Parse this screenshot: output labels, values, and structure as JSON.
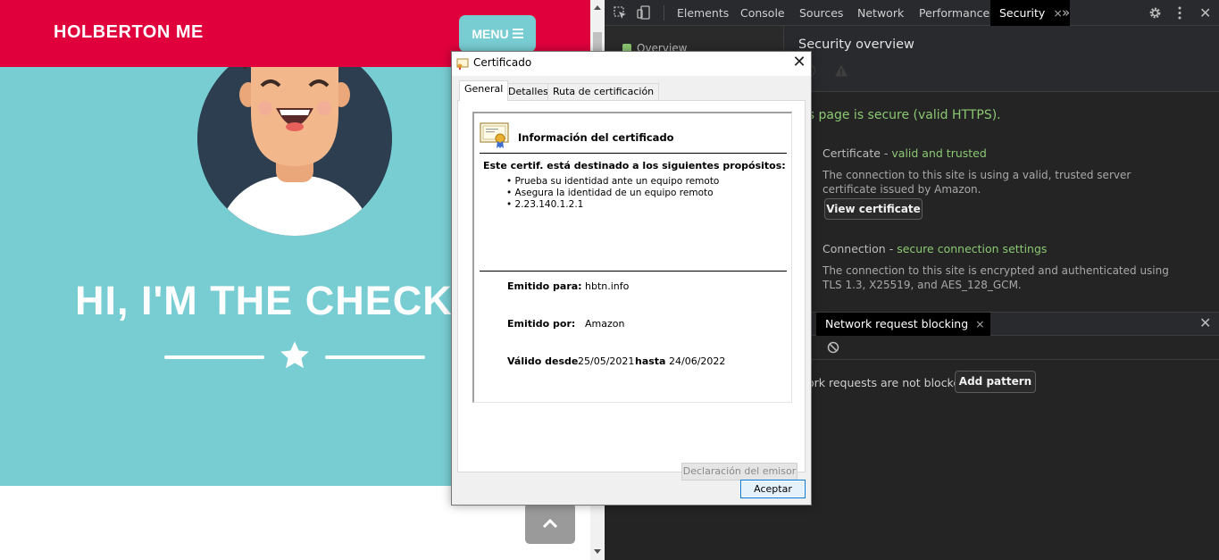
{
  "site": {
    "brand": "HOLBERTON ME",
    "menu_label": "MENU",
    "hero_title": "HI, I'M THE CHECK",
    "colors": {
      "nav": "#e0003c",
      "hero": "#78cdd3"
    }
  },
  "devtools": {
    "tabs": [
      "Elements",
      "Console",
      "Sources",
      "Network",
      "Performance",
      "Security"
    ],
    "active_tab": "Security",
    "sidebar_item": "Overview",
    "security": {
      "title": "Security overview",
      "secure_message": "his page is secure (valid HTTPS).",
      "certificate_label": "Certificate - ",
      "certificate_status": "valid and trusted",
      "certificate_desc": "The connection to this site is using a valid, trusted server certificate issued by Amazon.",
      "view_certificate": "View certificate",
      "connection_label": "Connection - ",
      "connection_status": "secure connection settings",
      "connection_desc": "The connection to this site is encrypted and authenticated using TLS 1.3, X25519, and AES_128_GCM."
    },
    "drawer": {
      "tab": "Network request blocking",
      "message": "ork requests are not blocked.",
      "add_pattern": "Add pattern"
    }
  },
  "cert_dialog": {
    "title": "Certificado",
    "tabs": [
      "General",
      "Detalles",
      "Ruta de certificación"
    ],
    "info_title": "Información del certificado",
    "purpose_heading": "Este certif. está destinado a los siguientes propósitos:",
    "purposes": [
      "• Prueba su identidad ante un equipo remoto",
      "• Asegura la identidad de un equipo remoto",
      "• 2.23.140.1.2.1"
    ],
    "issued_to_label": "Emitido para:",
    "issued_to": "hbtn.info",
    "issued_by_label": "Emitido por:",
    "issued_by": "Amazon",
    "valid_from_label": "Válido desde",
    "valid_from": "25/05/2021",
    "valid_to_label": "hasta",
    "valid_to": "24/06/2022",
    "issuer_statement": "Declaración del emisor",
    "accept": "Aceptar"
  }
}
